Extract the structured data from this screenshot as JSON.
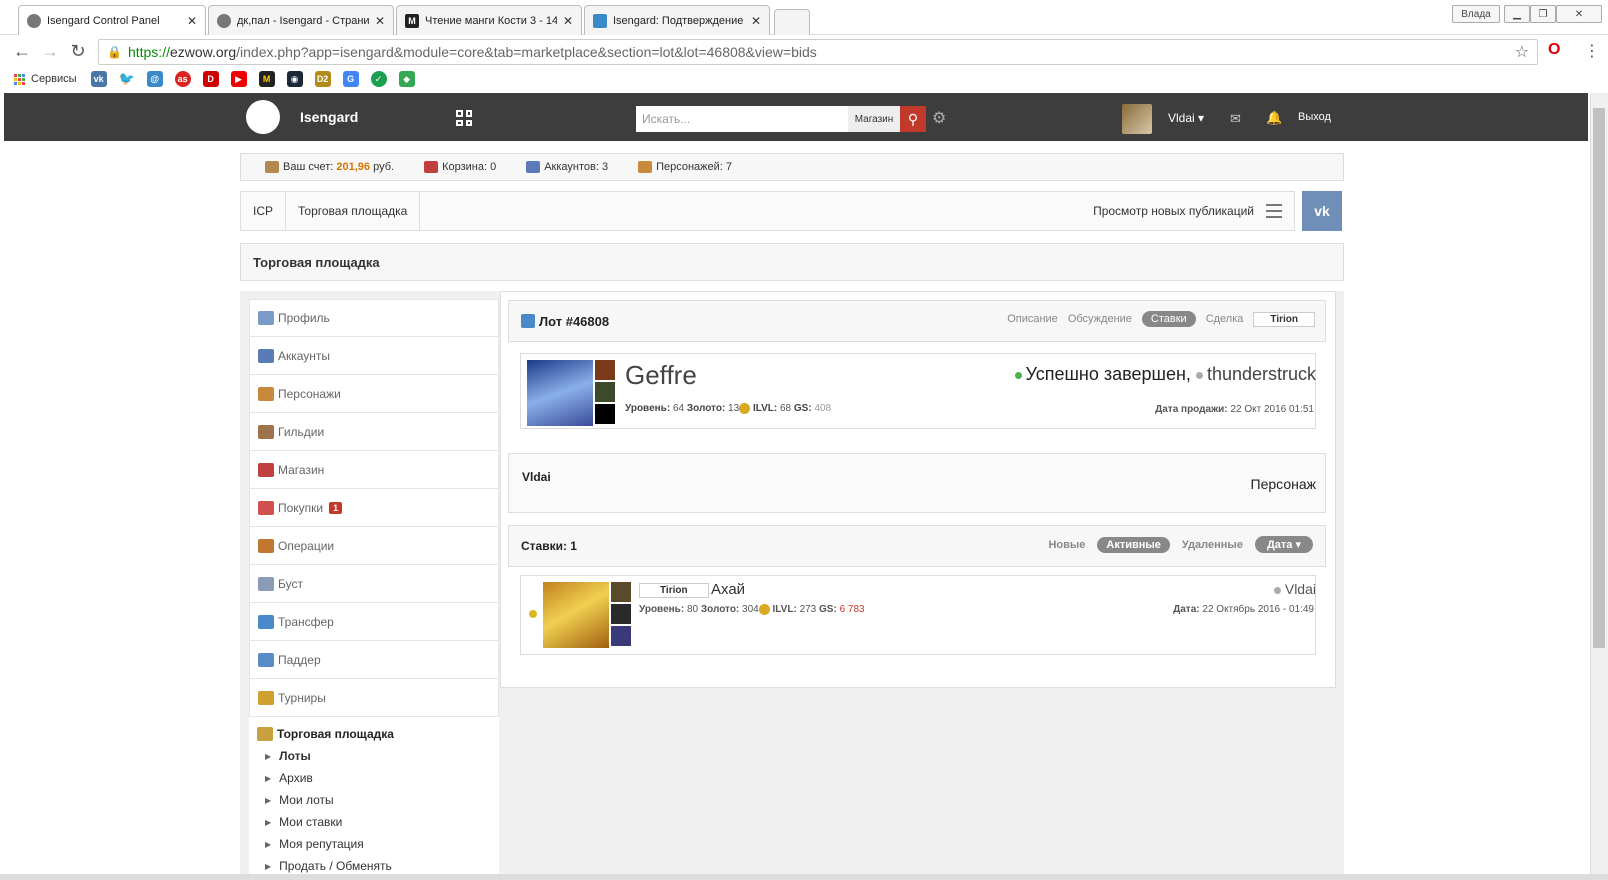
{
  "browser": {
    "tabs": [
      {
        "label": "Isengard Control Panel",
        "active": true
      },
      {
        "label": "дк,пал - Isengard - Страни"
      },
      {
        "label": "Чтение манги Кости 3 - 14"
      },
      {
        "label": "Isengard: Подтверждение"
      }
    ],
    "window_user": "Влада",
    "url_https": "https://",
    "url_host": "ezwow.org",
    "url_path": "/index.php?app=isengard&module=core&tab=marketplace&section=lot&lot=46808&view=bids",
    "bookmarks_label": "Сервисы"
  },
  "topnav": {
    "brand": "Isengard",
    "search_placeholder": "Искать...",
    "search_category": "Магазин",
    "username": "Vldai",
    "logout": "Выход"
  },
  "status": {
    "account_label": "Ваш счет:",
    "account_value": "201,96",
    "account_currency": "руб.",
    "cart": "Корзина: 0",
    "accounts": "Аккаунтов: 3",
    "characters": "Персонажей: 7"
  },
  "breadcrumb": {
    "root": "ICP",
    "section": "Торговая площадка",
    "new_pubs": "Просмотр новых публикаций"
  },
  "page_title": "Торговая площадка",
  "sidebar": {
    "items": [
      {
        "label": "Профиль",
        "color": "#7a9ac8"
      },
      {
        "label": "Аккаунты",
        "color": "#5a7ab8"
      },
      {
        "label": "Персонажи",
        "color": "#c88a3a"
      },
      {
        "label": "Гильдии",
        "color": "#a0724a"
      },
      {
        "label": "Магазин",
        "color": "#c04040"
      },
      {
        "label": "Покупки",
        "color": "#d05050",
        "badge": "1"
      },
      {
        "label": "Операции",
        "color": "#c07830"
      },
      {
        "label": "Буст",
        "color": "#8a9ab8"
      },
      {
        "label": "Трансфер",
        "color": "#4a8ac8"
      },
      {
        "label": "Паддер",
        "color": "#5a8ac8"
      },
      {
        "label": "Турниры",
        "color": "#d0a030"
      }
    ],
    "market": {
      "title": "Торговая площадка",
      "links": [
        "Лоты",
        "Архив",
        "Мои лоты",
        "Мои ставки",
        "Моя репутация",
        "Продать / Обменять"
      ]
    }
  },
  "lot": {
    "title": "Лот #46808",
    "tabs": [
      "Описание",
      "Обсуждение",
      "Ставки",
      "Сделка"
    ],
    "active_tab": "Ставки",
    "realm": "Tirion",
    "char_name": "Geffre",
    "level_label": "Уровень:",
    "level": "64",
    "gold_label": "Золото:",
    "gold": "13",
    "ilvl_label": "ILVL:",
    "ilvl": "68",
    "gs_label": "GS:",
    "gs": "408",
    "status": "Успешно завершен,",
    "buyer": "thunderstruck",
    "sale_date_label": "Дата продажи:",
    "sale_date": "22 Окт 2016 01:51"
  },
  "seller": {
    "name": "Vldai",
    "type": "Персонаж"
  },
  "bids": {
    "title": "Ставки: 1",
    "tabs": [
      "Новые",
      "Активные",
      "Удаленные"
    ],
    "active_tab": "Активные",
    "sort": "Дата",
    "entries": [
      {
        "realm": "Tirion",
        "char": "Ахай",
        "level_label": "Уровень:",
        "level": "80",
        "gold_label": "Золото:",
        "gold": "304",
        "ilvl_label": "ILVL:",
        "ilvl": "273",
        "gs_label": "GS:",
        "gs": "6 783",
        "bidder": "Vldai",
        "date_label": "Дата:",
        "date": "22 Октябрь 2016 - 01:49"
      }
    ]
  }
}
